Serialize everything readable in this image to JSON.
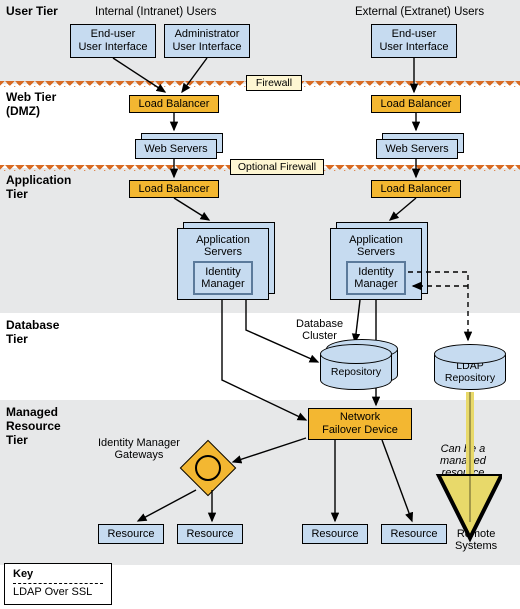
{
  "tiers": {
    "user": "User Tier",
    "web": "Web Tier\n(DMZ)",
    "app": "Application\nTier",
    "db": "Database\nTier",
    "mgd": "Managed\nResource\nTier"
  },
  "headers": {
    "internal": "Internal (Intranet) Users",
    "external": "External (Extranet) Users"
  },
  "nodes": {
    "enduser_ui": "End-user\nUser Interface",
    "admin_ui": "Administrator\nUser Interface",
    "firewall": "Firewall",
    "optional_firewall": "Optional Firewall",
    "load_balancer": "Load Balancer",
    "web_servers": "Web Servers",
    "app_servers": "Application\nServers",
    "identity_mgr": "Identity\nManager",
    "db_cluster": "Database\nCluster",
    "repository": "Repository",
    "ldap_repo": "LDAP\nRepository",
    "net_failover": "Network\nFailover Device",
    "idm_gateways": "Identity Manager\nGateways",
    "resource": "Resource",
    "can_be": "Can be a\nmanaged\nresource",
    "remote": "Remote\nSystems"
  },
  "key": {
    "title": "Key",
    "line1": "LDAP Over SSL"
  }
}
